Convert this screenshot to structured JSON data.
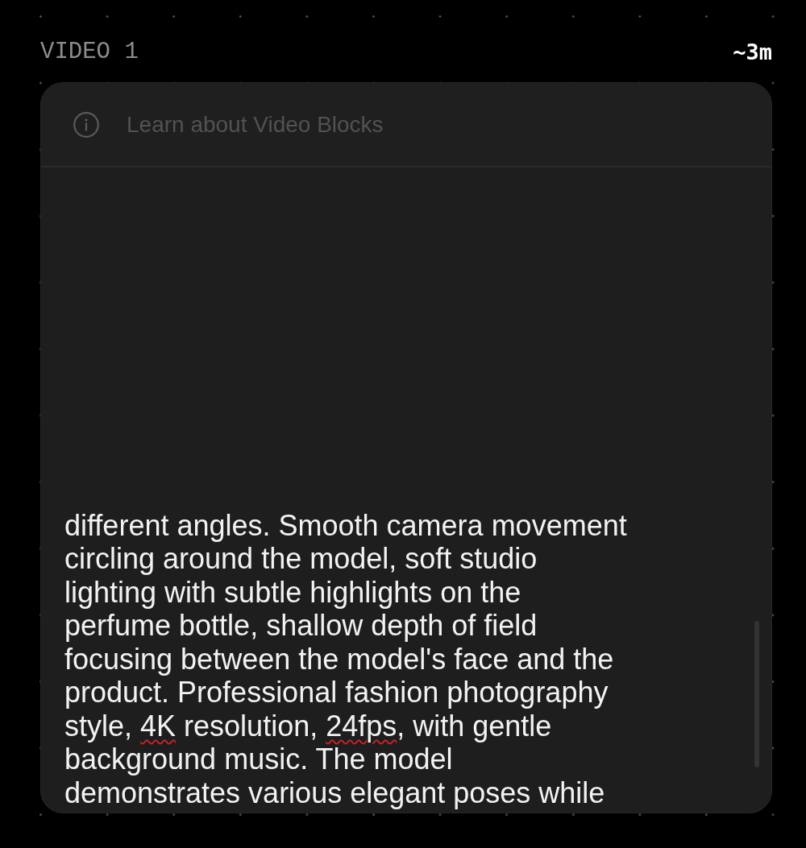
{
  "section": {
    "label": "VIDEO 1",
    "duration": "~3m"
  },
  "card": {
    "info_link": "Learn about Video Blocks",
    "prompt": {
      "segments": [
        {
          "text": "different angles. Smooth camera movement circling around the model, soft studio lighting with subtle highlights on the perfume bottle, shallow depth of field focusing between the model's face and the product. Professional fashion photography style, ",
          "misspelled": false
        },
        {
          "text": "4K",
          "misspelled": true
        },
        {
          "text": " resolution, ",
          "misspelled": false
        },
        {
          "text": "24fps",
          "misspelled": true
        },
        {
          "text": ", with gentle background music. The model demonstrates various elegant poses while",
          "misspelled": false
        }
      ]
    }
  }
}
